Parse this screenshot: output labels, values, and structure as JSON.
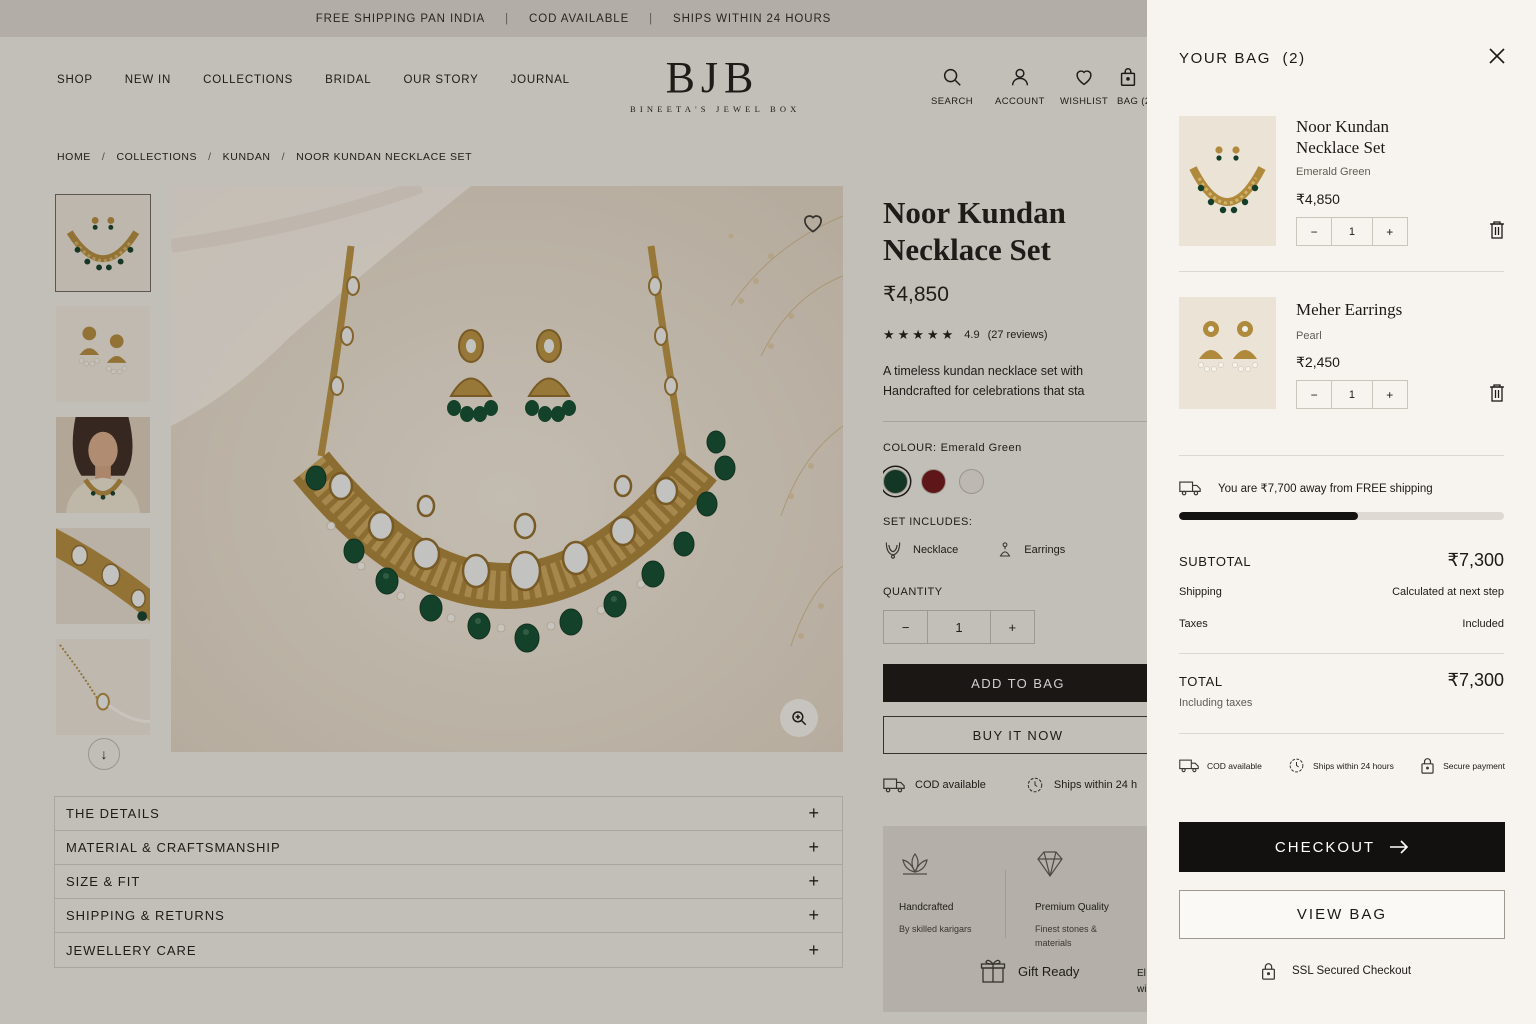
{
  "announcement": [
    "FREE SHIPPING PAN INDIA",
    "COD AVAILABLE",
    "SHIPS WITHIN 24 HOURS"
  ],
  "nav": [
    "SHOP",
    "NEW IN",
    "COLLECTIONS",
    "BRIDAL",
    "OUR STORY",
    "JOURNAL"
  ],
  "logo": {
    "mark": "BJB",
    "tagline": "BINEETA'S JEWEL BOX"
  },
  "utility": {
    "search": "SEARCH",
    "account": "ACCOUNT",
    "wishlist": "WISHLIST",
    "bag": "BAG (2"
  },
  "breadcrumb": [
    "HOME",
    "COLLECTIONS",
    "KUNDAN",
    "NOOR KUNDAN NECKLACE SET"
  ],
  "product": {
    "title": "Noor Kundan Necklace Set",
    "price": "₹4,850",
    "rating": "4.9",
    "reviews": "(27 reviews)",
    "stars": 5,
    "desc_line1": "A timeless kundan necklace set with",
    "desc_line2": "Handcrafted for celebrations that sta",
    "colour_label": "COLOUR:",
    "colour_value": "Emerald Green",
    "swatches": [
      "#0e3b27",
      "#6e1218",
      "#e7e2da"
    ],
    "includes_label": "SET INCLUDES:",
    "includes": [
      "Necklace",
      "Earrings"
    ],
    "quantity_label": "QUANTITY",
    "quantity": "1",
    "add_to_bag": "ADD TO BAG",
    "buy_now": "BUY IT NOW",
    "features": [
      "COD available",
      "Ships within 24 h"
    ],
    "promo": {
      "handcrafted": "Handcrafted",
      "handcrafted_sub": "By skilled karigars",
      "premium": "Premium Quality",
      "premium_sub_1": "Finest stones &",
      "premium_sub_2": "materials",
      "gift": "Gift Ready",
      "cut_1": "El",
      "cut_2": "wi"
    }
  },
  "accordion": [
    "THE DETAILS",
    "MATERIAL & CRAFTSMANSHIP",
    "SIZE & FIT",
    "SHIPPING & RETURNS",
    "JEWELLERY CARE"
  ],
  "cart": {
    "title": "YOUR BAG",
    "count": "(2)",
    "items": [
      {
        "name_1": "Noor Kundan",
        "name_2": "Necklace Set",
        "variant": "Emerald Green",
        "price": "₹4,850",
        "qty": "1"
      },
      {
        "name_1": "Meher Earrings",
        "variant": "Pearl",
        "price": "₹2,450",
        "qty": "1"
      }
    ],
    "shipping_note": "You are ₹7,700 away from FREE shipping",
    "shipping_progress": 0.55,
    "subtotal_label": "SUBTOTAL",
    "subtotal": "₹7,300",
    "shipping_label": "Shipping",
    "shipping_value": "Calculated at next step",
    "taxes_label": "Taxes",
    "taxes_value": "Included",
    "total_label": "TOTAL",
    "total": "₹7,300",
    "including_taxes": "Including taxes",
    "trust": [
      "COD available",
      "Ships within 24 hours",
      "Secure payment"
    ],
    "checkout": "CHECKOUT",
    "view_bag": "VIEW BAG",
    "ssl": "SSL Secured Checkout"
  }
}
